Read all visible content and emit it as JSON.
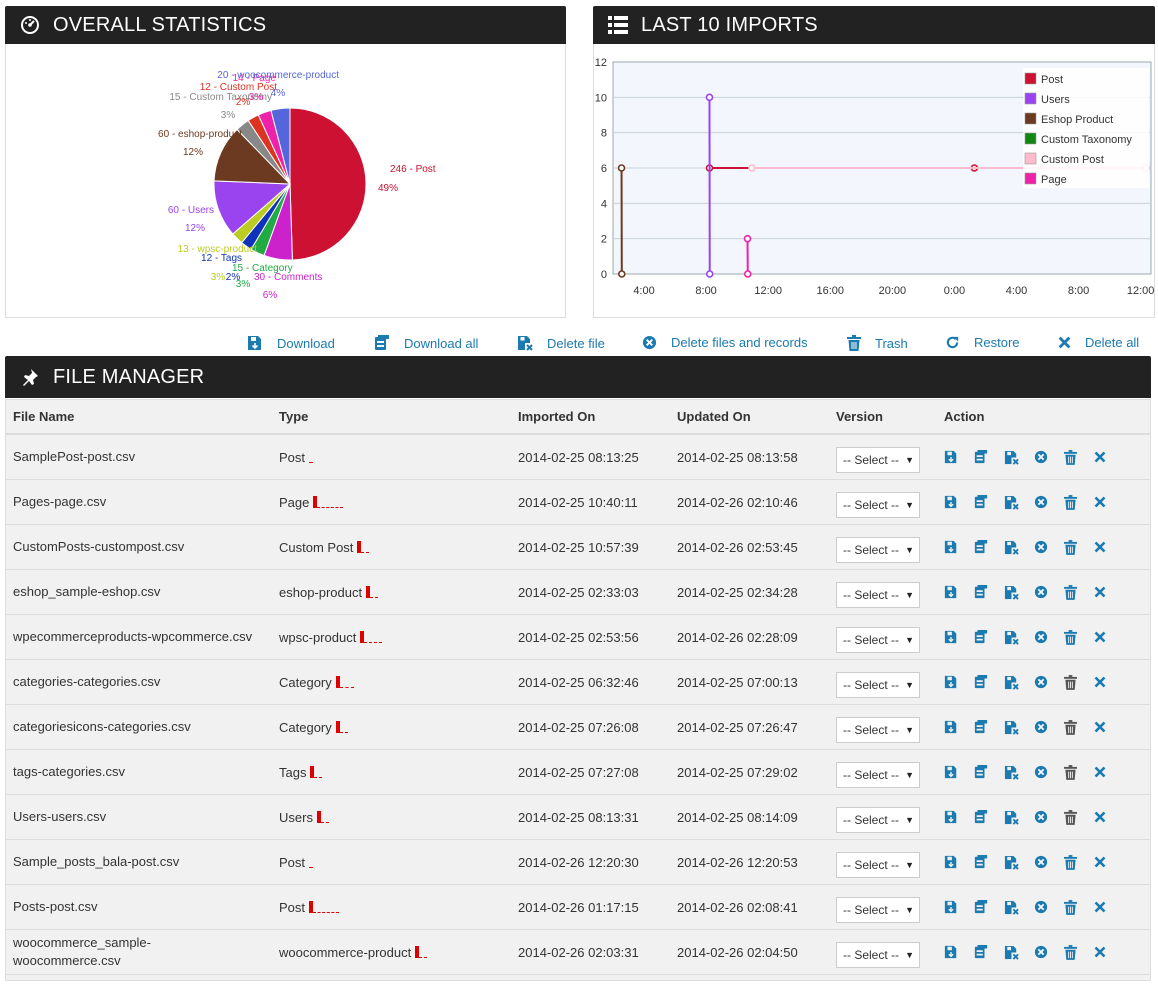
{
  "stats_panel": {
    "title": "OVERALL STATISTICS"
  },
  "imports_panel": {
    "title": "LAST 10 IMPORTS"
  },
  "file_manager": {
    "title": "FILE MANAGER"
  },
  "colors": {
    "header_bg": "#222222",
    "accent": "#1b7ab0",
    "post": "#cc1133",
    "bar_red": "#dd0000"
  },
  "chart_data": [
    {
      "type": "pie",
      "slices": [
        {
          "label": "246 - Post",
          "pct": "49%",
          "value": 246,
          "color": "#cc1133"
        },
        {
          "label": "30 - Comments",
          "pct": "6%",
          "value": 30,
          "color": "#cc22cc"
        },
        {
          "label": "15 - Category",
          "pct": "3%",
          "value": 15,
          "color": "#22aa44"
        },
        {
          "label": "12 - Tags",
          "pct": "2%",
          "value": 12,
          "color": "#1133bb"
        },
        {
          "label": "13 - wpsc-product",
          "pct": "3%",
          "value": 13,
          "color": "#bbcc22"
        },
        {
          "label": "60 - Users",
          "pct": "12%",
          "value": 60,
          "color": "#9944ee"
        },
        {
          "label": "60 - eshop-product",
          "pct": "12%",
          "value": 60,
          "color": "#6b3a20"
        },
        {
          "label": "15 - Custom Taxonomy",
          "pct": "3%",
          "value": 15,
          "color": "#888888"
        },
        {
          "label": "12 - Custom Post",
          "pct": "2%",
          "value": 12,
          "color": "#dd3322"
        },
        {
          "label": "14 - Page",
          "pct": "3%",
          "value": 14,
          "color": "#ee22aa"
        },
        {
          "label": "20 - woocommerce-product",
          "pct": "4%",
          "value": 20,
          "color": "#5566dd"
        }
      ]
    },
    {
      "type": "line",
      "x_ticks": [
        "4:00",
        "8:00",
        "12:00",
        "16:00",
        "20:00",
        "0:00",
        "4:00",
        "8:00",
        "12:00"
      ],
      "y_ticks": [
        "0",
        "2",
        "4",
        "6",
        "8",
        "10",
        "12"
      ],
      "ylim": [
        0,
        12
      ],
      "legend": [
        {
          "name": "Post",
          "color": "#cc1133"
        },
        {
          "name": "Users",
          "color": "#9944ee"
        },
        {
          "name": "Eshop Product",
          "color": "#6b3a20"
        },
        {
          "name": "Custom Taxonomy",
          "color": "#118811"
        },
        {
          "name": "Custom Post",
          "color": "#ffbbcc"
        },
        {
          "name": "Page",
          "color": "#ee22aa"
        }
      ],
      "series": [
        {
          "name": "Post",
          "x": [
            "2014-02-25 08:13",
            "2014-02-26 01:17",
            "2014-02-26 12:20"
          ],
          "y": [
            6,
            6,
            6
          ]
        },
        {
          "name": "Users",
          "x": [
            "2014-02-25 08:13",
            "2014-02-25 08:14"
          ],
          "y": [
            10,
            0
          ]
        },
        {
          "name": "Eshop Product",
          "x": [
            "2014-02-25 02:33",
            "2014-02-25 02:34"
          ],
          "y": [
            6,
            0
          ]
        },
        {
          "name": "Custom Post",
          "x": [
            "2014-02-25 10:57",
            "2014-02-26 12:20"
          ],
          "y": [
            6,
            6
          ]
        },
        {
          "name": "Page",
          "x": [
            "2014-02-25 10:40",
            "2014-02-25 10:41"
          ],
          "y": [
            2,
            0
          ]
        }
      ]
    }
  ],
  "toolbar": [
    {
      "label": "Download",
      "icon": "download-icon"
    },
    {
      "label": "Download all",
      "icon": "download-all-icon"
    },
    {
      "label": "Delete file",
      "icon": "delete-file-icon"
    },
    {
      "label": "Delete files and records",
      "icon": "delete-records-icon"
    },
    {
      "label": "Trash",
      "icon": "trash-icon"
    },
    {
      "label": "Restore",
      "icon": "restore-icon"
    },
    {
      "label": "Delete all",
      "icon": "delete-all-icon"
    }
  ],
  "table": {
    "headers": [
      "File Name",
      "Type",
      "Imported On",
      "Updated On",
      "Version",
      "Action"
    ],
    "select_label": "-- Select --",
    "rows": [
      {
        "file": "SamplePost-post.csv",
        "type": "Post",
        "imported": "2014-02-25 08:13:25",
        "updated": "2014-02-25 08:13:58",
        "bar": 0.1,
        "dashes": 4,
        "trash_grey": false
      },
      {
        "file": "Pages-page.csv",
        "type": "Page",
        "imported": "2014-02-25 10:40:11",
        "updated": "2014-02-26 02:10:46",
        "bar": 1,
        "dashes": 26,
        "trash_grey": false
      },
      {
        "file": "CustomPosts-custompost.csv",
        "type": "Custom Post",
        "imported": "2014-02-25 10:57:39",
        "updated": "2014-02-26 02:53:45",
        "bar": 1,
        "dashes": 8,
        "trash_grey": false
      },
      {
        "file": "eshop_sample-eshop.csv",
        "type": "eshop-product",
        "imported": "2014-02-25 02:33:03",
        "updated": "2014-02-25 02:34:28",
        "bar": 1,
        "dashes": 8,
        "trash_grey": false
      },
      {
        "file": "wpecommerceproducts-wpcommerce.csv",
        "type": "wpsc-product",
        "imported": "2014-02-25 02:53:56",
        "updated": "2014-02-26 02:28:09",
        "bar": 1,
        "dashes": 18,
        "trash_grey": false
      },
      {
        "file": "categories-categories.csv",
        "type": "Category",
        "imported": "2014-02-25 06:32:46",
        "updated": "2014-02-25 07:00:13",
        "bar": 1,
        "dashes": 14,
        "trash_grey": true
      },
      {
        "file": "categoriesicons-categories.csv",
        "type": "Category",
        "imported": "2014-02-25 07:26:08",
        "updated": "2014-02-25 07:26:47",
        "bar": 1,
        "dashes": 8,
        "trash_grey": true
      },
      {
        "file": "tags-categories.csv",
        "type": "Tags",
        "imported": "2014-02-25 07:27:08",
        "updated": "2014-02-25 07:29:02",
        "bar": 1,
        "dashes": 8,
        "trash_grey": true
      },
      {
        "file": "Users-users.csv",
        "type": "Users",
        "imported": "2014-02-25 08:13:31",
        "updated": "2014-02-25 08:14:09",
        "bar": 1,
        "dashes": 8,
        "trash_grey": true
      },
      {
        "file": "Sample_posts_bala-post.csv",
        "type": "Post",
        "imported": "2014-02-26 12:20:30",
        "updated": "2014-02-26 12:20:53",
        "bar": 0.1,
        "dashes": 4,
        "trash_grey": false
      },
      {
        "file": "Posts-post.csv",
        "type": "Post",
        "imported": "2014-02-26 01:17:15",
        "updated": "2014-02-26 02:08:41",
        "bar": 1,
        "dashes": 26,
        "trash_grey": false
      },
      {
        "file": "woocommerce_sample-\nwoocommerce.csv",
        "type": "woocommerce-product",
        "imported": "2014-02-26 02:03:31",
        "updated": "2014-02-26 02:04:50",
        "bar": 1,
        "dashes": 8,
        "trash_grey": false
      }
    ]
  }
}
